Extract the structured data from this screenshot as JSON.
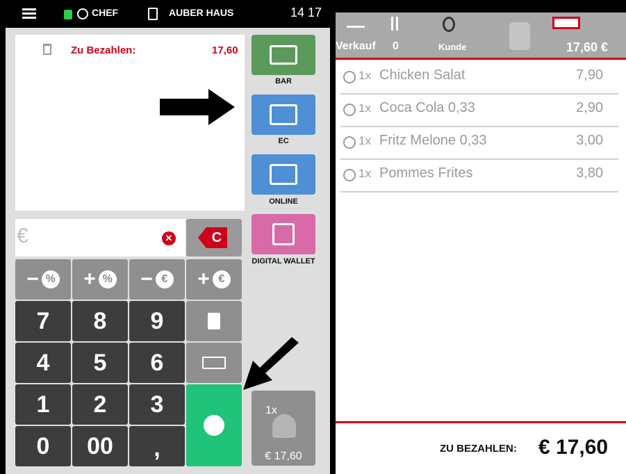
{
  "header": {
    "user": "CHEF",
    "location": "AUBER HAUS",
    "time": "14 17"
  },
  "payment": {
    "label": "Zu Bezahlen:",
    "amount": "17,60"
  },
  "input": {
    "placeholder": "€"
  },
  "keypad": {
    "clear_label": "C",
    "discount_keys": [
      "−",
      "%",
      "+",
      "%",
      "−",
      "€",
      "+",
      "€"
    ],
    "digits": [
      "7",
      "8",
      "9",
      "4",
      "5",
      "6",
      "1",
      "2",
      "3",
      "0",
      "00",
      ","
    ]
  },
  "payment_methods": [
    {
      "label": "BAR",
      "color": "#5b9a5b"
    },
    {
      "label": "EC",
      "color": "#4e8fd6"
    },
    {
      "label": "ONLINE",
      "color": "#4e8fd6"
    },
    {
      "label": "DIGITAL WALLET",
      "color": "#d86aa8"
    }
  ],
  "split_button": {
    "count": "1x",
    "amount": "€ 17,60"
  },
  "order_header": {
    "mode": "Verkauf",
    "seats": "0",
    "customer": "Kunde",
    "total": "17,60 €"
  },
  "items": [
    {
      "qty": "1x",
      "name": "Chicken Salat",
      "price": "7,90"
    },
    {
      "qty": "1x",
      "name": "Coca Cola 0,33",
      "price": "2,90"
    },
    {
      "qty": "1x",
      "name": "Fritz Melone 0,33",
      "price": "3,00"
    },
    {
      "qty": "1x",
      "name": "Pommes Frites",
      "price": "3,80"
    }
  ],
  "footer": {
    "label": "ZU BEZAHLEN:",
    "total": "€ 17,60"
  },
  "colors": {
    "accent_red": "#d0021b",
    "confirm_green": "#1fc37a"
  }
}
